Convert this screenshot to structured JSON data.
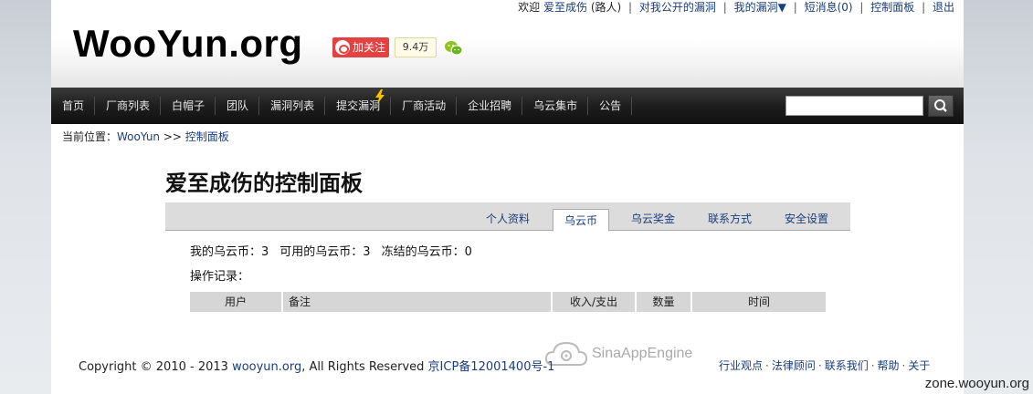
{
  "topbar": {
    "welcome": "欢迎",
    "username": "爱至成伤",
    "role": "(路人)",
    "links": [
      "对我公开的漏洞",
      "我的漏洞▼",
      "短消息(0)",
      "控制面板",
      "退出"
    ]
  },
  "logo": {
    "text": "WooYun.org"
  },
  "social": {
    "follow_label": "加关注",
    "follower_count": "9.4万"
  },
  "nav": {
    "items": [
      "首页",
      "厂商列表",
      "白帽子",
      "团队",
      "漏洞列表",
      "提交漏洞",
      "厂商活动",
      "企业招聘",
      "乌云集市",
      "公告"
    ],
    "search_placeholder": ""
  },
  "breadcrumb": {
    "prefix": "当前位置：",
    "home": "WooYun",
    "separator": ">>",
    "current": "控制面板"
  },
  "main": {
    "title": "爱至成伤的控制面板",
    "tabs": [
      {
        "label": "个人资料",
        "active": false
      },
      {
        "label": "乌云币",
        "active": true
      },
      {
        "label": "乌云奖金",
        "active": false
      },
      {
        "label": "联系方式",
        "active": false
      },
      {
        "label": "安全设置",
        "active": false
      }
    ],
    "coins": {
      "mine": "我的乌云币：3",
      "available": "可用的乌云币：3",
      "frozen": "冻结的乌云币：0"
    },
    "records_label": "操作记录：",
    "table_headers": [
      "用户",
      "备注",
      "收入/支出",
      "数量",
      "时间"
    ]
  },
  "footer": {
    "copyright": "Copyright © 2010 - 2013",
    "site_link": "wooyun.org",
    "rights": ", All Rights Reserved",
    "icp": "京ICP备12001400号-1",
    "sae": "SinaAppEngine",
    "links": [
      "行业观点",
      "法律顾问",
      "联系我们",
      "帮助",
      "关于"
    ]
  },
  "watermark": "zone.wooyun.org",
  "colors": {
    "link": "#1a3d7c",
    "nav_bg": "#1e1e1e",
    "weibo_red": "#e64141"
  }
}
